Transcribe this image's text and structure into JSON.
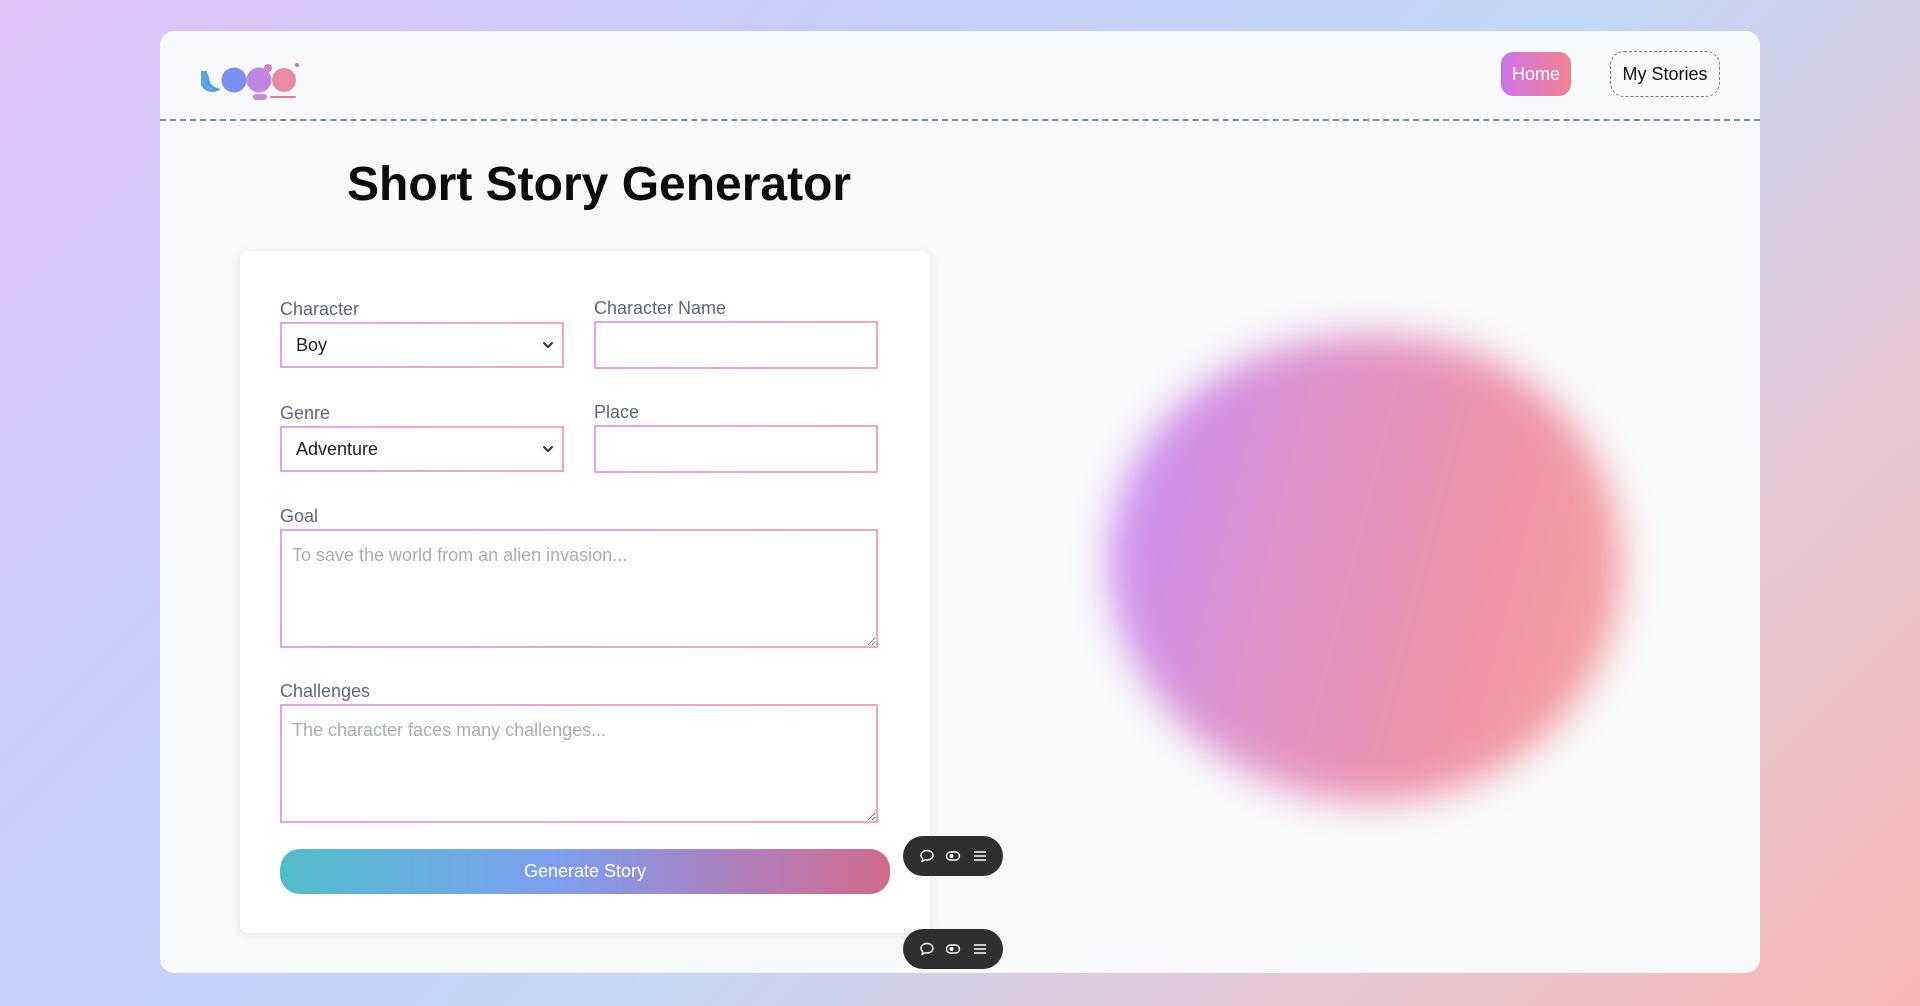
{
  "nav": {
    "home_label": "Home",
    "stories_label": "My Stories"
  },
  "page": {
    "title": "Short Story Generator"
  },
  "form": {
    "character": {
      "label": "Character",
      "value": "Boy"
    },
    "character_name": {
      "label": "Character Name",
      "value": ""
    },
    "genre": {
      "label": "Genre",
      "value": "Adventure"
    },
    "place": {
      "label": "Place",
      "value": ""
    },
    "goal": {
      "label": "Goal",
      "placeholder": "To save the world from an alien invasion..."
    },
    "challenges": {
      "label": "Challenges",
      "placeholder": "The character faces many challenges..."
    },
    "submit_label": "Generate Story"
  },
  "floating_toolbars": [
    {
      "icons": [
        "comment-icon",
        "eye-icon",
        "menu-icon"
      ]
    },
    {
      "icons": [
        "comment-icon",
        "eye-icon",
        "menu-icon"
      ]
    }
  ],
  "colors": {
    "accent_pink": "#f2838e",
    "accent_purple": "#cd73e8",
    "button_teal": "#50bdc9",
    "button_rose": "#d06a87"
  }
}
